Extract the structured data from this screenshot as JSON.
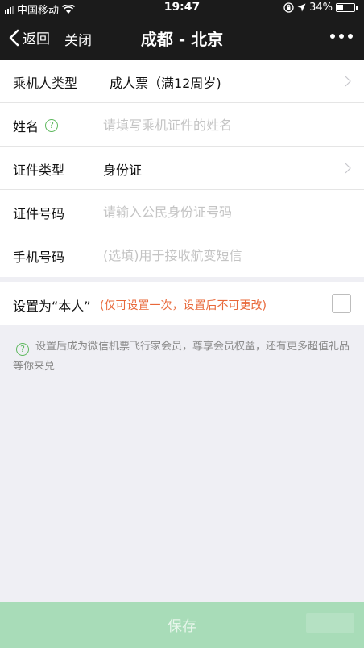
{
  "status_bar": {
    "carrier": "中国移动",
    "time": "19:47",
    "battery_text": "34%",
    "battery_level": 0.34,
    "icons": [
      "signal-icon",
      "wifi-icon",
      "rotation-lock-icon",
      "location-icon",
      "battery-icon"
    ]
  },
  "nav": {
    "back_label": "返回",
    "close_label": "关闭",
    "title": "成都 - 北京",
    "more_icon": "more-dots-icon"
  },
  "form": {
    "passenger_type": {
      "label": "乘机人类型",
      "value": "成人票（满12周岁)"
    },
    "name": {
      "label": "姓名",
      "placeholder": "请填写乘机证件的姓名",
      "value": ""
    },
    "id_type": {
      "label": "证件类型",
      "value": "身份证"
    },
    "id_number": {
      "label": "证件号码",
      "placeholder": "请输入公民身份证号码",
      "value": ""
    },
    "phone": {
      "label": "手机号码",
      "placeholder": "(选填)用于接收航变短信",
      "value": ""
    }
  },
  "self_setting": {
    "label": "设置为“本人”",
    "note": "(仅可设置一次，设置后不可更改)",
    "checked": false
  },
  "info": {
    "text": "设置后成为微信机票飞行家会员，尊享会员权益，还有更多超值礼品等你来兑"
  },
  "footer": {
    "save_label": "保存"
  },
  "colors": {
    "nav_bg": "#1b1b1b",
    "accent_green": "#5db85d",
    "note_orange": "#e8683a",
    "save_bg": "#a8dcb8",
    "page_bg": "#efeff4"
  }
}
